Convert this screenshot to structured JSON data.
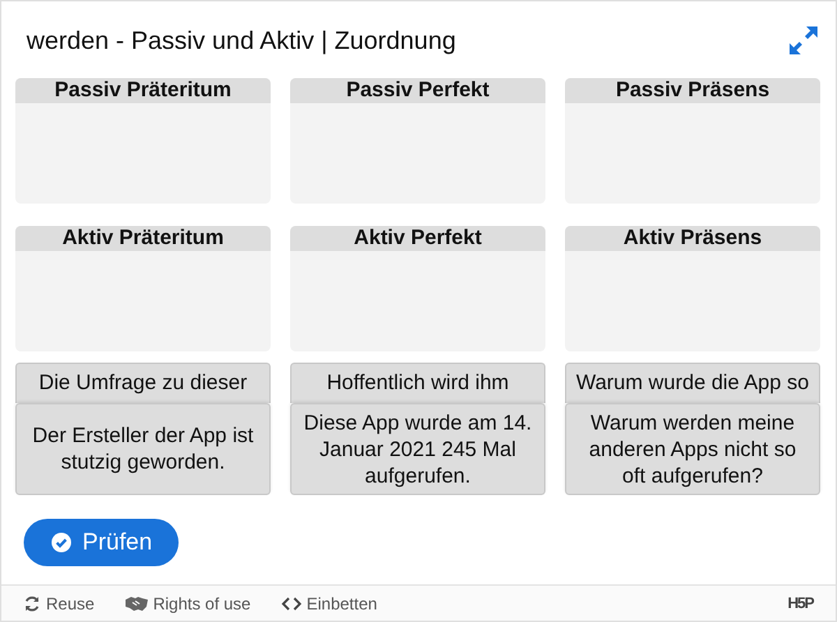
{
  "title": "werden - Passiv und Aktiv | Zuordnung",
  "dropzones": [
    {
      "label": "Passiv Präteritum"
    },
    {
      "label": "Passiv Perfekt"
    },
    {
      "label": "Passiv Präsens"
    },
    {
      "label": "Aktiv Präteritum"
    },
    {
      "label": "Aktiv Perfekt"
    },
    {
      "label": "Aktiv Präsens"
    }
  ],
  "card_stacks": [
    {
      "back": "Die Umfrage zu dieser",
      "front": "Der Ersteller der App ist stutzig geworden."
    },
    {
      "back": "Hoffentlich wird ihm",
      "front": "Diese App wurde am 14. Januar 2021 245 Mal aufgerufen."
    },
    {
      "back": "Warum wurde die App so",
      "front": "Warum werden meine anderen Apps nicht so oft aufgerufen?"
    }
  ],
  "check_button": "Prüfen",
  "footer": {
    "links": [
      {
        "kind": "reuse",
        "label": "Reuse"
      },
      {
        "kind": "rights",
        "label": "Rights of use"
      },
      {
        "kind": "embed",
        "label": "Einbetten"
      }
    ],
    "logo": "H5P"
  }
}
